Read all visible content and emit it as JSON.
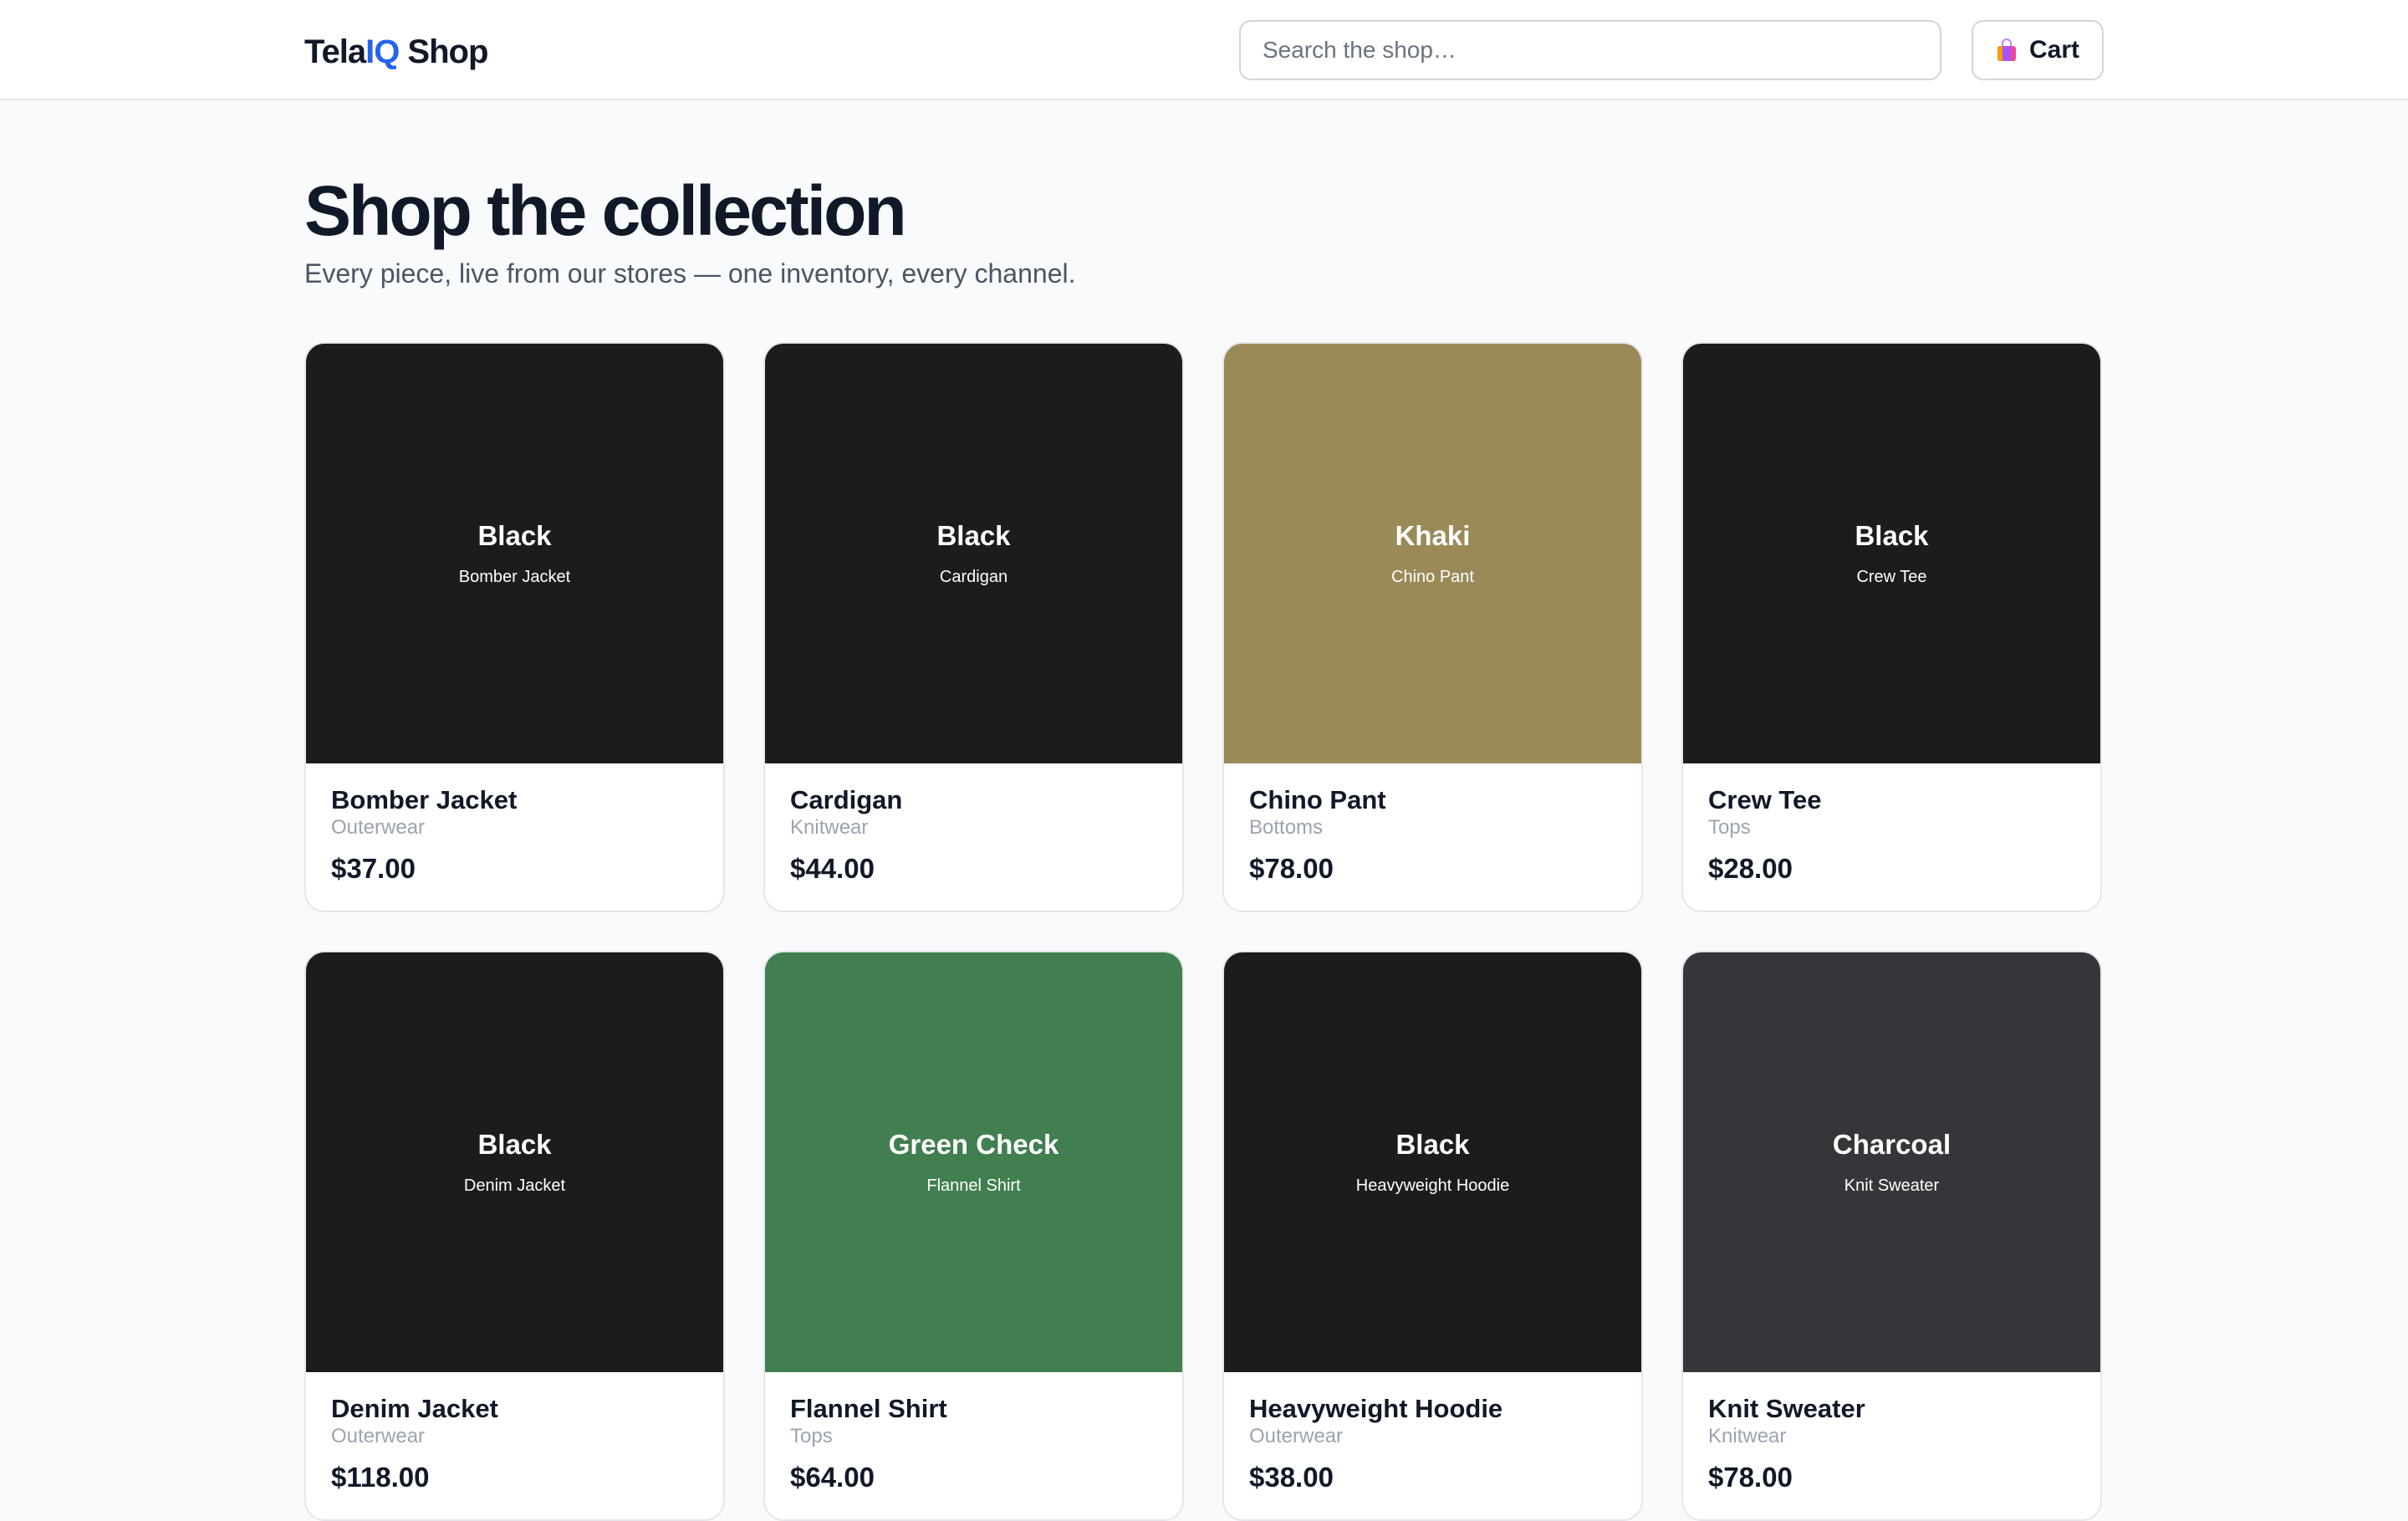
{
  "header": {
    "logo_part1": "Tela",
    "logo_part2": "IQ",
    "logo_part3": " Shop",
    "search_placeholder": "Search the shop…",
    "cart_label": "Cart",
    "cart_icon": "shopping-bag-icon"
  },
  "hero": {
    "title": "Shop the collection",
    "subtitle": "Every piece, live from our stores — one inventory, every channel."
  },
  "colors": {
    "accent": "#2563eb"
  },
  "products": [
    {
      "color_label": "Black",
      "swatch_name": "Bomber Jacket",
      "swatch_hex": "#1c1c1e",
      "name": "Bomber Jacket",
      "category": "Outerwear",
      "price": "$37.00"
    },
    {
      "color_label": "Black",
      "swatch_name": "Cardigan",
      "swatch_hex": "#1c1c1e",
      "name": "Cardigan",
      "category": "Knitwear",
      "price": "$44.00"
    },
    {
      "color_label": "Khaki",
      "swatch_name": "Chino Pant",
      "swatch_hex": "#9a8a58",
      "name": "Chino Pant",
      "category": "Bottoms",
      "price": "$78.00"
    },
    {
      "color_label": "Black",
      "swatch_name": "Crew Tee",
      "swatch_hex": "#1c1c1e",
      "name": "Crew Tee",
      "category": "Tops",
      "price": "$28.00"
    },
    {
      "color_label": "Black",
      "swatch_name": "Denim Jacket",
      "swatch_hex": "#1c1c1e",
      "name": "Denim Jacket",
      "category": "Outerwear",
      "price": "$118.00"
    },
    {
      "color_label": "Green Check",
      "swatch_name": "Flannel Shirt",
      "swatch_hex": "#417f50",
      "name": "Flannel Shirt",
      "category": "Tops",
      "price": "$64.00"
    },
    {
      "color_label": "Black",
      "swatch_name": "Heavyweight Hoodie",
      "swatch_hex": "#1c1c1e",
      "name": "Heavyweight Hoodie",
      "category": "Outerwear",
      "price": "$38.00"
    },
    {
      "color_label": "Charcoal",
      "swatch_name": "Knit Sweater",
      "swatch_hex": "#36363a",
      "name": "Knit Sweater",
      "category": "Knitwear",
      "price": "$78.00"
    }
  ]
}
